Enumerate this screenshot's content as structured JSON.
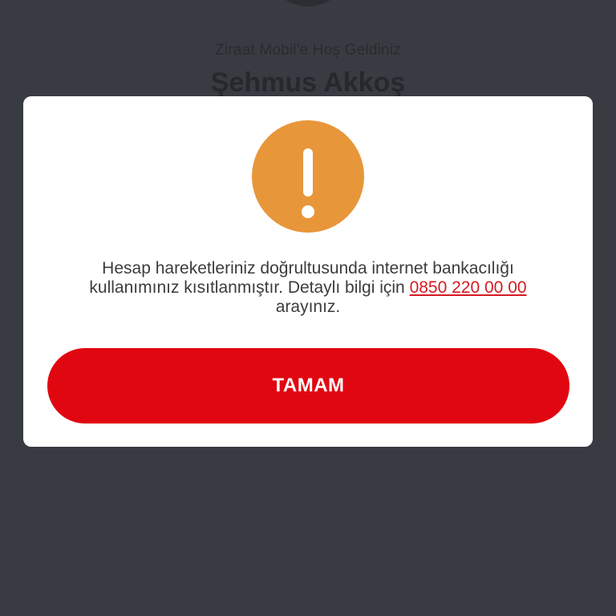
{
  "background": {
    "welcome_text": "Ziraat Mobil'e Hoş Geldiniz",
    "user_name": "Şehmus Akkoş"
  },
  "dialog": {
    "icon": "exclamation-warning-icon",
    "message_part1": "Hesap hareketleriniz doğrultusunda internet bankacılığı kullanımınız kısıtlanmıştır. Detaylı bilgi için",
    "phone_number": "0850 220 00 00",
    "message_part2": "arayınız.",
    "ok_button_label": "TAMAM"
  },
  "colors": {
    "background": "#393b42",
    "warning_icon": "#e8963a",
    "primary_button": "#e10711",
    "link": "#d51b23"
  }
}
